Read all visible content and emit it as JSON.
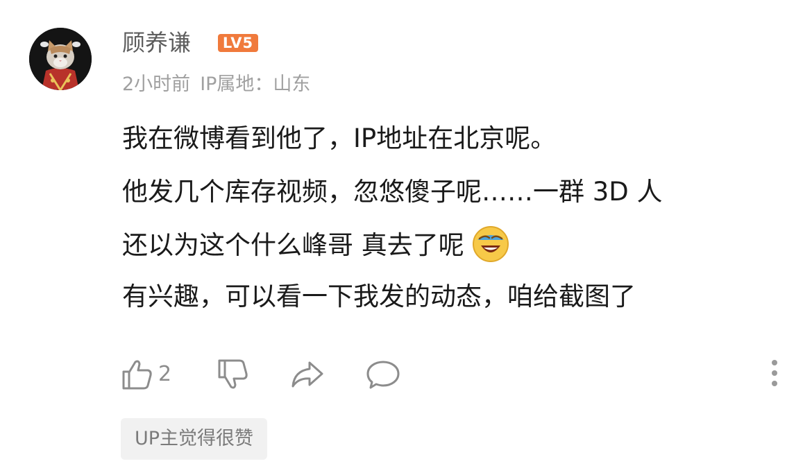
{
  "comment": {
    "username": "顾养谦",
    "level_badge": "LV5",
    "time": "2小时前",
    "ip_location": "IP属地：山东",
    "lines": [
      "我在微博看到他了，IP地址在北京呢。",
      "他发几个库存视频，忽悠傻子呢……一群 3D 人",
      "还以为这个什么峰哥 真去了呢",
      "有兴趣，可以看一下我发的动态，咱给截图了"
    ],
    "emoji": "laughing-crying-emoji",
    "like_count": "2",
    "up_tag": "UP主觉得很赞"
  },
  "colors": {
    "level_badge": "#f07a3c",
    "username": "#5d5d5d",
    "meta": "#a0a0a0",
    "text": "#1a1a1a",
    "icon": "#8c8c8c",
    "tag_bg": "#f1f1f1"
  }
}
